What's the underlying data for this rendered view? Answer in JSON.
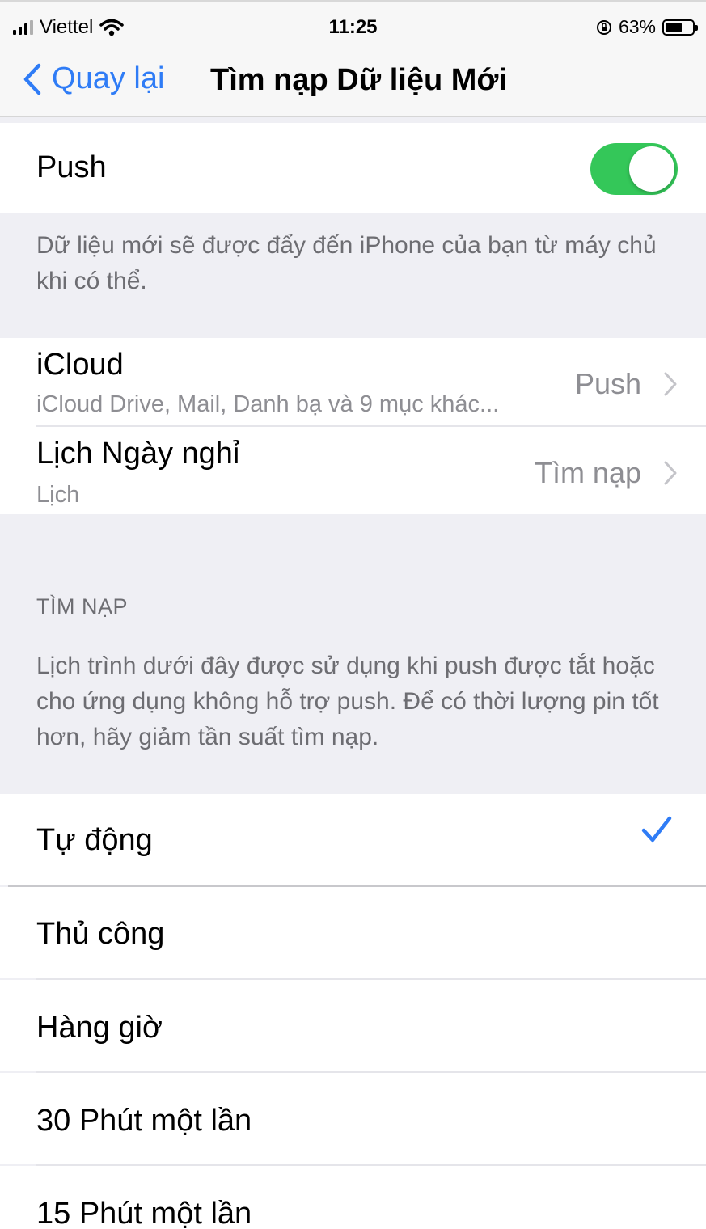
{
  "status_bar": {
    "carrier": "Viettel",
    "time": "11:25",
    "battery_text": "63%",
    "battery_level": 0.63,
    "icons": [
      "signal-icon",
      "wifi-icon",
      "rotation-lock-icon",
      "battery-icon"
    ]
  },
  "nav": {
    "back_label": "Quay lại",
    "title": "Tìm nạp Dữ liệu Mới"
  },
  "push": {
    "label": "Push",
    "enabled": true,
    "footer": "Dữ liệu mới sẽ được đẩy đến iPhone của bạn từ máy chủ khi có thể."
  },
  "accounts": [
    {
      "title": "iCloud",
      "subtitle": "iCloud Drive, Mail, Danh bạ và 9 mục khác...",
      "value": "Push"
    },
    {
      "title": "Lịch Ngày nghỉ",
      "subtitle": "Lịch",
      "value": "Tìm nạp"
    }
  ],
  "fetch": {
    "header": "TÌM NẠP",
    "description": "Lịch trình dưới đây được sử dụng khi push được tắt hoặc cho ứng dụng không hỗ trợ push. Để có thời lượng pin tốt hơn, hãy giảm tần suất tìm nạp.",
    "options": [
      "Tự động",
      "Thủ công",
      "Hàng giờ",
      "30 Phút một lần",
      "15 Phút một lần"
    ],
    "selected_index": 0
  },
  "colors": {
    "accent": "#2f7cf6",
    "toggle_on": "#34c759",
    "group_bg": "#efeff4"
  }
}
